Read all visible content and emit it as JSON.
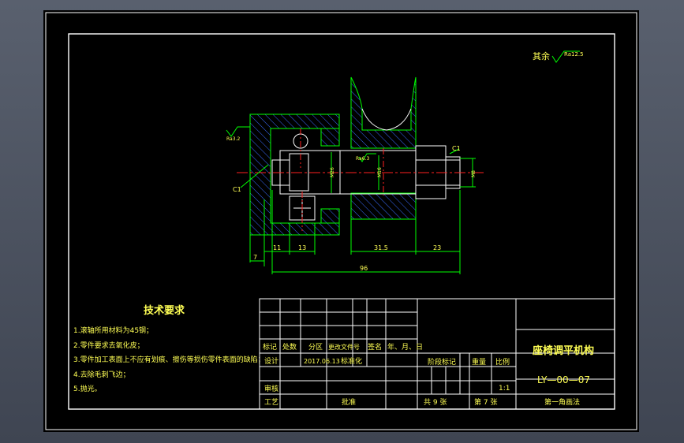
{
  "surface_note": "其余",
  "surface_roughness": "Ra12.5",
  "roughness_labels": [
    "Ra3.2",
    "Ra6.3"
  ],
  "chamfer_labels": [
    "C1",
    "C1"
  ],
  "dimensions": {
    "d7": "7",
    "d11": "11",
    "d13": "13",
    "d31_5": "31.5",
    "d23": "23",
    "d96": "96",
    "v_m8": "M8",
    "v_m16": "M16",
    "v_m26": "M26"
  },
  "tech": {
    "title": "技术要求",
    "items": [
      "1.滚轴所用材料为45钢；",
      "2.零件要求去氧化皮；",
      "3.零件加工表面上不应有划痕、擦伤等损伤零件表面的缺陷；",
      "4.去除毛刺飞边；",
      "5.抛光。"
    ]
  },
  "title_block": {
    "h_mark": "标记",
    "h_count": "处数",
    "h_zone": "分区",
    "h_doc": "更改文件号",
    "h_sign": "签名",
    "h_date": "年、月、日",
    "design": "设计",
    "design_date": "2017.06.13",
    "standard": "标准化",
    "review": "审核",
    "process": "工艺",
    "approve": "批准",
    "stage_mark": "阶段标记",
    "weight": "重量",
    "ratio_label": "比例",
    "ratio": "1:1",
    "sheets_total": "共 9 张",
    "sheet_no": "第 7 张",
    "part_name": "座椅调平机构",
    "drawing_no": "LY—00—07",
    "projection": "第一角画法"
  }
}
